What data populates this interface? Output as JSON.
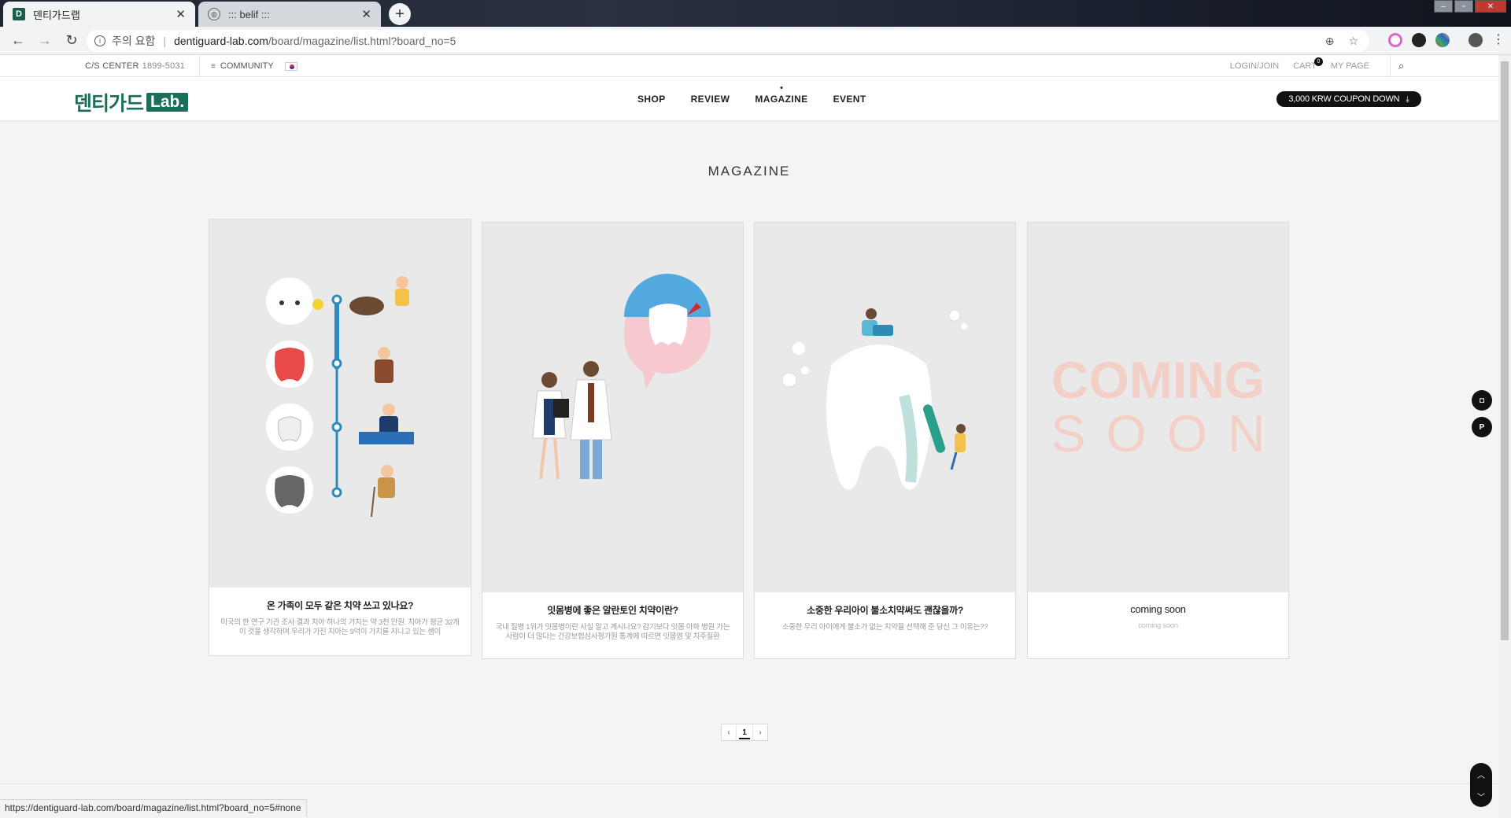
{
  "browser": {
    "tabs": [
      {
        "title": "덴티가드랩",
        "active": true
      },
      {
        "title": "::: belif :::",
        "active": false
      }
    ],
    "new_tab": "+",
    "security_label": "주의 요함",
    "url_host": "dentiguard-lab.com",
    "url_path": "/board/magazine/list.html?board_no=5",
    "status_url": "https://dentiguard-lab.com/board/magazine/list.html?board_no=5#none"
  },
  "util": {
    "cs_label": "C/S CENTER",
    "cs_phone": "1899-5031",
    "community": "COMMUNITY",
    "login": "LOGIN/JOIN",
    "cart": "CART",
    "cart_count": "0",
    "mypage": "MY PAGE"
  },
  "header": {
    "logo_text": "덴티가드",
    "logo_lab": "Lab.",
    "nav": [
      "SHOP",
      "REVIEW",
      "MAGAZINE",
      "EVENT"
    ],
    "active_nav": "MAGAZINE",
    "coupon": "3,000 KRW COUPON DOWN"
  },
  "page": {
    "title": "MAGAZINE"
  },
  "articles": [
    {
      "title": "온 가족이 모두 같은 치약 쓰고 있나요?",
      "summary": "미국의 한 연구 기관 조사 결과 치아 하나의 가치는 약 3천 만원. 치아가 평균 32개이 것을 생각하며 우리가 가진 치아는 9억이 가치를 지니고 있는 셈이"
    },
    {
      "title": "잇몸병에 좋은 알란토인 치약이란?",
      "summary": "국내 질병 1위가 잇몸병이란 사실 알고 계시나요? 감기보다 잇몸 아파 병원 가는 사람이 더 많다는 건강보험심사평가원 통계에 따르면 잇몸염 및 치주질환"
    },
    {
      "title": "소중한 우리아이 불소치약써도 괜찮을까?",
      "summary": "소중한 우리 아이에게 불소가 없는 치약을 선택해 준 당신 그 이유는??"
    },
    {
      "title": "coming soon",
      "summary": "coming soon",
      "thumb_line1": "COMING",
      "thumb_line2": "SOON"
    }
  ],
  "pagination": {
    "prev": "‹",
    "current": "1",
    "next": "›"
  },
  "side_buttons": [
    "instagram-icon",
    "p-icon"
  ],
  "colors": {
    "brand": "#1b6e5a",
    "coming_soon": "#f3d0c7"
  }
}
